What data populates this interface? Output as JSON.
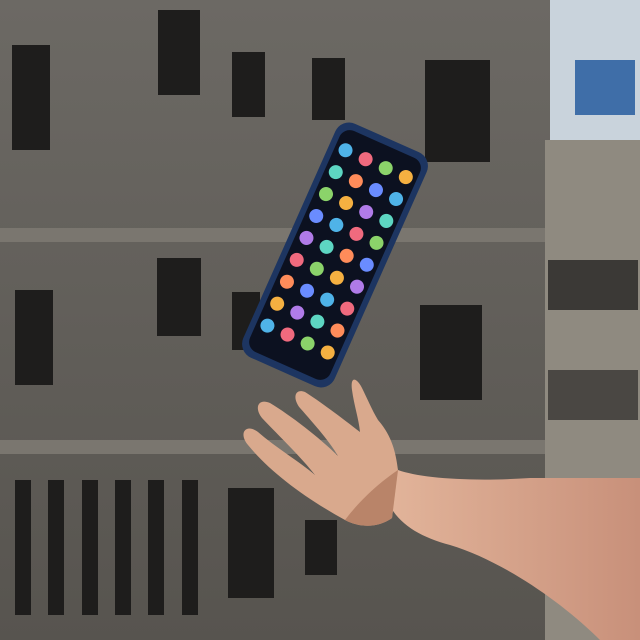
{
  "scene": {
    "subjects": [
      "concrete-building",
      "floating-smartphone",
      "open-hand"
    ],
    "colors": {
      "concrete": "#6f6b66",
      "concrete_dark": "#55524e",
      "window": "#1e1d1c",
      "sky": "#c9d3dc",
      "phone_frame": "#1d3561",
      "screen": "#0c1120",
      "skin": "#d9a98d",
      "skin_shadow": "#b98469"
    },
    "app_icon_colors": [
      "#4fb3e8",
      "#f06a7e",
      "#8bd36a",
      "#f5b041",
      "#b07be8",
      "#5dd6c2",
      "#ff8c5a",
      "#6a8cff"
    ]
  }
}
